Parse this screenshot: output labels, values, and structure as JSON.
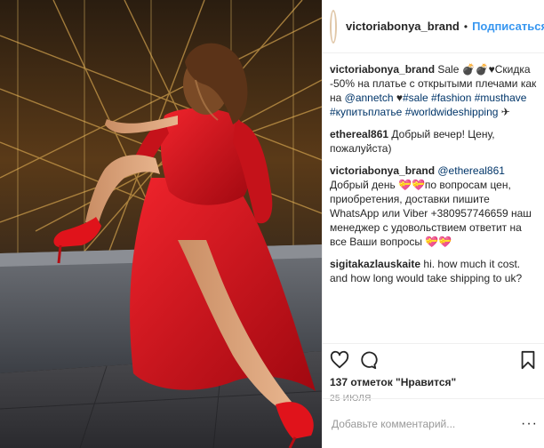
{
  "photo": {
    "description_icon": "photo"
  },
  "header": {
    "username": "victoriabonya_brand",
    "separator": "•",
    "follow_label": "Подписаться"
  },
  "comments": [
    {
      "user": "victoriabonya_brand",
      "parts": [
        {
          "t": "text",
          "v": " Sale 💣💣♥Скидка -50% на платье с открытыми плечами как на "
        },
        {
          "t": "link",
          "v": "@annetch"
        },
        {
          "t": "text",
          "v": " ♥"
        },
        {
          "t": "link",
          "v": "#sale"
        },
        {
          "t": "text",
          "v": " "
        },
        {
          "t": "link",
          "v": "#fashion"
        },
        {
          "t": "text",
          "v": " "
        },
        {
          "t": "link",
          "v": "#musthave"
        },
        {
          "t": "text",
          "v": " "
        },
        {
          "t": "link",
          "v": "#купитьплатье"
        },
        {
          "t": "text",
          "v": " "
        },
        {
          "t": "link",
          "v": "#worldwideshipping"
        },
        {
          "t": "text",
          "v": " ✈"
        }
      ]
    },
    {
      "user": "ethereal861",
      "parts": [
        {
          "t": "text",
          "v": " Добрый вечер! Цену, пожалуйста)"
        }
      ]
    },
    {
      "user": "victoriabonya_brand",
      "parts": [
        {
          "t": "text",
          "v": " "
        },
        {
          "t": "link",
          "v": "@ethereal861"
        },
        {
          "t": "text",
          "v": " Добрый день 💝💝по вопросам цен, приобретения, доставки пишите WhatsApp или Viber +380957746659 наш менеджер с удовольствием ответит на все Ваши вопросы 💝💝"
        }
      ]
    },
    {
      "user": "sigitakazlauskaite",
      "parts": [
        {
          "t": "text",
          "v": " hi. how much it cost. and how long would take shipping to uk?"
        }
      ]
    }
  ],
  "actions": {
    "like_icon": "heart-icon",
    "comment_icon": "comment-icon",
    "save_icon": "bookmark-icon",
    "likes_text": "137 отметок \"Нравится\"",
    "date_text": "25 ИЮЛЯ"
  },
  "add_comment": {
    "placeholder": "Добавьте комментарий...",
    "more_label": "···"
  },
  "colors": {
    "link": "#003569",
    "follow": "#3897f0",
    "dress": "#d8141c"
  }
}
